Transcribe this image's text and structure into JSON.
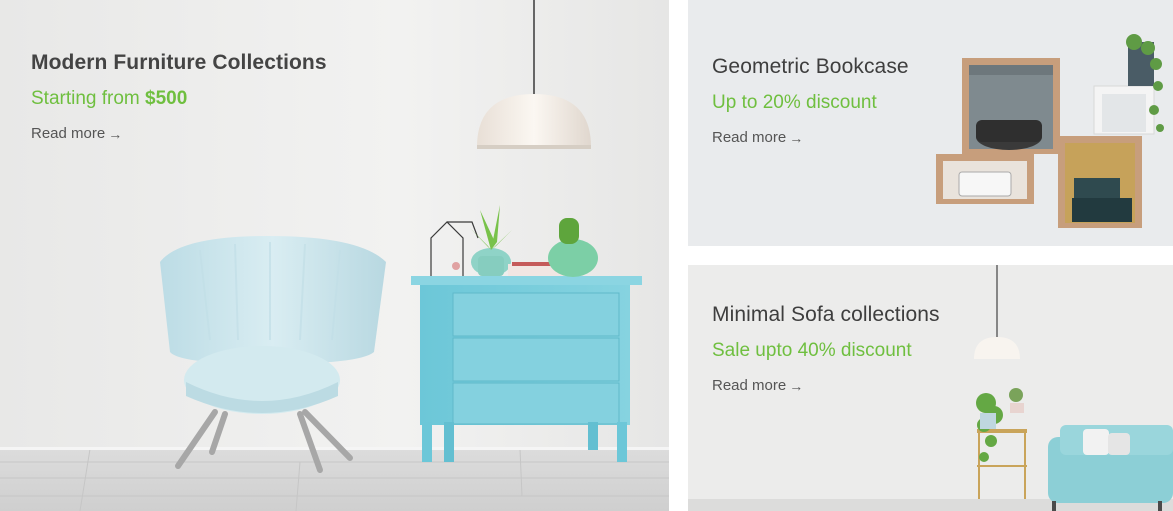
{
  "banners": [
    {
      "title": "Modern Furniture Collections",
      "subtitle_prefix": "Starting from ",
      "subtitle_highlight": "$500",
      "link": "Read more",
      "link_icon": "arrow-right-icon"
    },
    {
      "title": "Geometric Bookcase",
      "subtitle": "Up to 20% discount",
      "link": "Read more",
      "link_icon": "arrow-right-icon"
    },
    {
      "title": "Minimal Sofa collections",
      "subtitle": "Sale upto 40% discount",
      "link": "Read more",
      "link_icon": "arrow-right-icon"
    }
  ],
  "colors": {
    "accent_green": "#6fbf3f",
    "title_text": "#3e3e3e",
    "link_text": "#555555",
    "dresser_blue": "#7fd0de",
    "chair_blue": "#cfe6ec"
  }
}
